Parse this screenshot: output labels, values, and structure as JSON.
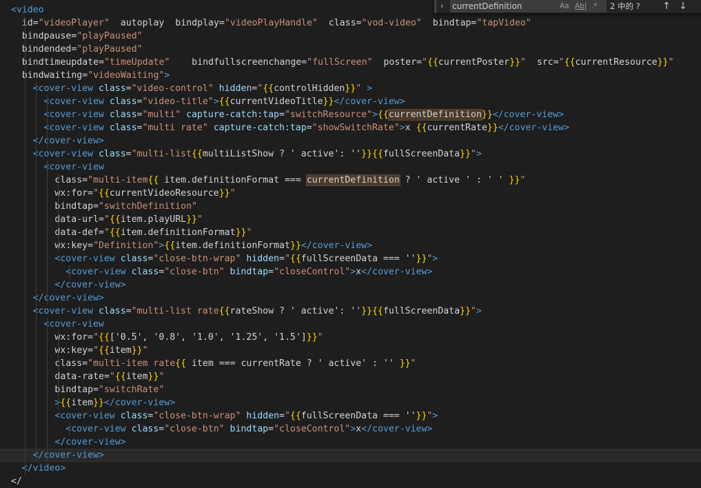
{
  "find_widget": {
    "query": "currentDefinition",
    "option_case": "Aa",
    "option_word": "Ab|",
    "option_regex": ".*",
    "match_count": "2 中的 ?",
    "toggle_icon": "chevron-right-icon",
    "prev_icon": "arrow-up-icon",
    "next_icon": "arrow-down-icon"
  },
  "code_lines": [
    "  <video",
    "    id=\"videoPlayer\"  autoplay  bindplay=\"videoPlayHandle\"  class=\"vod-video\"  bindtap=\"tapVideo\"",
    "    bindpause=\"playPaused\"",
    "    bindended=\"playPaused\"",
    "    bindtimeupdate=\"timeUpdate\"    bindfullscreenchange=\"fullScreen\"  poster=\"{{currentPoster}}\"  src=\"{{currentResource}}\"",
    "    bindwaiting=\"videoWaiting\">",
    "      <cover-view class=\"video-control\" hidden=\"{{controlHidden}}\" >",
    "        <cover-view class=\"video-title\">{{currentVideoTitle}}</cover-view>",
    "        <cover-view class=\"multi\" capture-catch:tap=\"switchResource\">{{currentDefinition}}</cover-view>",
    "        <cover-view class=\"multi rate\" capture-catch:tap=\"showSwitchRate\">x {{currentRate}}</cover-view>",
    "      </cover-view>",
    "      <cover-view class=\"multi-list{{multiListShow ? ' active': ''}}{{fullScreenData}}\">",
    "        <cover-view",
    "          class=\"multi-item{{ item.definitionFormat === currentDefinition ? ' active ' : ' ' }}\"",
    "          wx:for=\"{{currentVideoResource}}\"",
    "          bindtap=\"switchDefinition\"",
    "          data-url=\"{{item.playURL}}\"",
    "          data-def=\"{{item.definitionFormat}}\"",
    "          wx:key=\"Definition\">{{item.definitionFormat}}</cover-view>",
    "          <cover-view class=\"close-btn-wrap\" hidden=\"{{fullScreenData === ''}}\">",
    "            <cover-view class=\"close-btn\" bindtap=\"closeControl\">x</cover-view>",
    "          </cover-view>",
    "      </cover-view>",
    "      <cover-view class=\"multi-list rate{{rateShow ? ' active': ''}}{{fullScreenData}}\">",
    "        <cover-view",
    "          wx:for=\"{{['0.5', '0.8', '1.0', '1.25', '1.5']}}\"",
    "          wx:key=\"{{item}}\"",
    "          class=\"multi-item rate{{ item === currentRate ? ' active' : '' }}\"",
    "          data-rate=\"{{item}}\"",
    "          bindtap=\"switchRate\"",
    "          >{{item}}</cover-view>",
    "          <cover-view class=\"close-btn-wrap\" hidden=\"{{fullScreenData === ''}}\">",
    "            <cover-view class=\"close-btn\" bindtap=\"closeControl\">x</cover-view>",
    "          </cover-view>",
    "      </cover-view>",
    "    </video>",
    "  </"
  ],
  "colors": {
    "background": "#1e1e1e",
    "tag": "#569cd6",
    "attribute": "#9cdcfe",
    "string": "#ce9178",
    "text": "#d4d4d4",
    "brace": "#ffd700"
  }
}
